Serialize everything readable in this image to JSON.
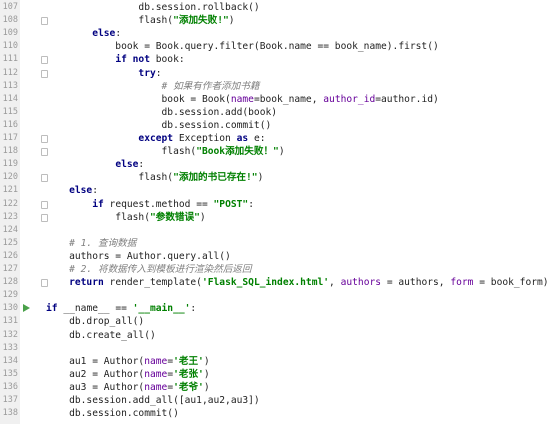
{
  "editor": {
    "lines": [
      {
        "n": "107",
        "fold": false,
        "run": false,
        "tokens": [
          {
            "t": "                db.session.rollback()",
            "c": ""
          }
        ]
      },
      {
        "n": "108",
        "fold": true,
        "run": false,
        "tokens": [
          {
            "t": "                flash(",
            "c": ""
          },
          {
            "t": "\"添加失败!\"",
            "c": "str"
          },
          {
            "t": ")",
            "c": ""
          }
        ]
      },
      {
        "n": "109",
        "fold": false,
        "run": false,
        "tokens": [
          {
            "t": "        ",
            "c": ""
          },
          {
            "t": "else",
            "c": "kw"
          },
          {
            "t": ":",
            "c": ""
          }
        ]
      },
      {
        "n": "110",
        "fold": false,
        "run": false,
        "tokens": [
          {
            "t": "            book = Book.query.filter(Book.name == book_name).first()",
            "c": ""
          }
        ]
      },
      {
        "n": "111",
        "fold": true,
        "run": false,
        "tokens": [
          {
            "t": "            ",
            "c": ""
          },
          {
            "t": "if not",
            "c": "kw"
          },
          {
            "t": " book:",
            "c": ""
          }
        ]
      },
      {
        "n": "112",
        "fold": true,
        "run": false,
        "tokens": [
          {
            "t": "                ",
            "c": ""
          },
          {
            "t": "try",
            "c": "kw"
          },
          {
            "t": ":",
            "c": ""
          }
        ]
      },
      {
        "n": "113",
        "fold": false,
        "run": false,
        "tokens": [
          {
            "t": "                    ",
            "c": ""
          },
          {
            "t": "# 如果有作者添加书籍",
            "c": "cmt"
          }
        ]
      },
      {
        "n": "114",
        "fold": false,
        "run": false,
        "tokens": [
          {
            "t": "                    book = Book(",
            "c": ""
          },
          {
            "t": "name",
            "c": "param"
          },
          {
            "t": "=book_name, ",
            "c": ""
          },
          {
            "t": "author_id",
            "c": "param"
          },
          {
            "t": "=author.id)",
            "c": ""
          }
        ]
      },
      {
        "n": "115",
        "fold": false,
        "run": false,
        "tokens": [
          {
            "t": "                    db.session.add(book)",
            "c": ""
          }
        ]
      },
      {
        "n": "116",
        "fold": false,
        "run": false,
        "tokens": [
          {
            "t": "                    db.session.commit()",
            "c": ""
          }
        ]
      },
      {
        "n": "117",
        "fold": true,
        "run": false,
        "tokens": [
          {
            "t": "                ",
            "c": ""
          },
          {
            "t": "except",
            "c": "kw"
          },
          {
            "t": " Exception ",
            "c": ""
          },
          {
            "t": "as",
            "c": "kw"
          },
          {
            "t": " e:",
            "c": ""
          }
        ]
      },
      {
        "n": "118",
        "fold": true,
        "run": false,
        "tokens": [
          {
            "t": "                    flash(",
            "c": ""
          },
          {
            "t": "\"Book添加失败！\"",
            "c": "str"
          },
          {
            "t": ")",
            "c": ""
          }
        ]
      },
      {
        "n": "119",
        "fold": false,
        "run": false,
        "tokens": [
          {
            "t": "            ",
            "c": ""
          },
          {
            "t": "else",
            "c": "kw"
          },
          {
            "t": ":",
            "c": ""
          }
        ]
      },
      {
        "n": "120",
        "fold": true,
        "run": false,
        "tokens": [
          {
            "t": "                flash(",
            "c": ""
          },
          {
            "t": "\"添加的书已存在!\"",
            "c": "str"
          },
          {
            "t": ")",
            "c": ""
          }
        ]
      },
      {
        "n": "121",
        "fold": false,
        "run": false,
        "tokens": [
          {
            "t": "    ",
            "c": ""
          },
          {
            "t": "else",
            "c": "kw"
          },
          {
            "t": ":",
            "c": ""
          }
        ]
      },
      {
        "n": "122",
        "fold": true,
        "run": false,
        "tokens": [
          {
            "t": "        ",
            "c": ""
          },
          {
            "t": "if",
            "c": "kw"
          },
          {
            "t": " request.method == ",
            "c": ""
          },
          {
            "t": "\"POST\"",
            "c": "str"
          },
          {
            "t": ":",
            "c": ""
          }
        ]
      },
      {
        "n": "123",
        "fold": true,
        "run": false,
        "tokens": [
          {
            "t": "            flash(",
            "c": ""
          },
          {
            "t": "\"参数错误\"",
            "c": "str"
          },
          {
            "t": ")",
            "c": ""
          }
        ]
      },
      {
        "n": "124",
        "fold": false,
        "run": false,
        "tokens": [
          {
            "t": "",
            "c": ""
          }
        ]
      },
      {
        "n": "125",
        "fold": false,
        "run": false,
        "tokens": [
          {
            "t": "    ",
            "c": ""
          },
          {
            "t": "# 1. 查询数据",
            "c": "cmt"
          }
        ]
      },
      {
        "n": "126",
        "fold": false,
        "run": false,
        "tokens": [
          {
            "t": "    authors = Author.query.all()",
            "c": ""
          }
        ]
      },
      {
        "n": "127",
        "fold": false,
        "run": false,
        "tokens": [
          {
            "t": "    ",
            "c": ""
          },
          {
            "t": "# 2. 将数据传入到模板进行渲染然后返回",
            "c": "cmt"
          }
        ]
      },
      {
        "n": "128",
        "fold": true,
        "run": false,
        "tokens": [
          {
            "t": "    ",
            "c": ""
          },
          {
            "t": "return",
            "c": "kw"
          },
          {
            "t": " render_template(",
            "c": ""
          },
          {
            "t": "'Flask_SQL_index.html'",
            "c": "str"
          },
          {
            "t": ", ",
            "c": ""
          },
          {
            "t": "authors",
            "c": "param"
          },
          {
            "t": " = authors, ",
            "c": ""
          },
          {
            "t": "form",
            "c": "param"
          },
          {
            "t": " = book_form)",
            "c": ""
          }
        ]
      },
      {
        "n": "129",
        "fold": false,
        "run": false,
        "tokens": [
          {
            "t": "",
            "c": ""
          }
        ]
      },
      {
        "n": "130",
        "fold": false,
        "run": true,
        "tokens": [
          {
            "t": "if",
            "c": "kw"
          },
          {
            "t": " __name__ == ",
            "c": ""
          },
          {
            "t": "'__main__'",
            "c": "str"
          },
          {
            "t": ":",
            "c": ""
          }
        ]
      },
      {
        "n": "131",
        "fold": false,
        "run": false,
        "tokens": [
          {
            "t": "    db.drop_all()",
            "c": ""
          }
        ]
      },
      {
        "n": "132",
        "fold": false,
        "run": false,
        "tokens": [
          {
            "t": "    db.create_all()",
            "c": ""
          }
        ]
      },
      {
        "n": "133",
        "fold": false,
        "run": false,
        "tokens": [
          {
            "t": "",
            "c": ""
          }
        ]
      },
      {
        "n": "134",
        "fold": false,
        "run": false,
        "tokens": [
          {
            "t": "    au1 = Author(",
            "c": ""
          },
          {
            "t": "name",
            "c": "param"
          },
          {
            "t": "=",
            "c": ""
          },
          {
            "t": "'老王'",
            "c": "str"
          },
          {
            "t": ")",
            "c": ""
          }
        ]
      },
      {
        "n": "135",
        "fold": false,
        "run": false,
        "tokens": [
          {
            "t": "    au2 = Author(",
            "c": ""
          },
          {
            "t": "name",
            "c": "param"
          },
          {
            "t": "=",
            "c": ""
          },
          {
            "t": "'老张'",
            "c": "str"
          },
          {
            "t": ")",
            "c": ""
          }
        ]
      },
      {
        "n": "136",
        "fold": false,
        "run": false,
        "tokens": [
          {
            "t": "    au3 = Author(",
            "c": ""
          },
          {
            "t": "name",
            "c": "param"
          },
          {
            "t": "=",
            "c": ""
          },
          {
            "t": "'老爷'",
            "c": "str"
          },
          {
            "t": ")",
            "c": ""
          }
        ]
      },
      {
        "n": "137",
        "fold": false,
        "run": false,
        "tokens": [
          {
            "t": "    db.session.add_all([au1,au2,au3])",
            "c": ""
          }
        ]
      },
      {
        "n": "138",
        "fold": false,
        "run": false,
        "tokens": [
          {
            "t": "    db.session.commit()",
            "c": ""
          }
        ]
      }
    ]
  }
}
